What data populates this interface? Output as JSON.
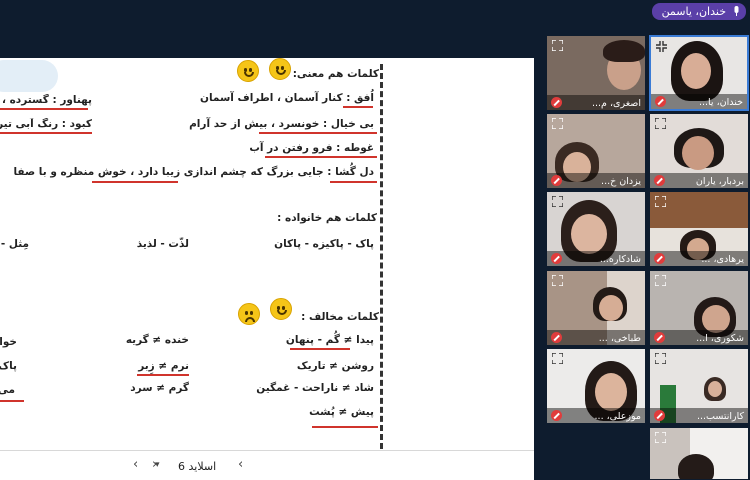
{
  "speaker": {
    "name": "خندان، یاسمن",
    "icon": "microphone-icon"
  },
  "slide": {
    "heading_synonyms": "کلمات هم معنی:",
    "heading_family": "کلمات هم خانواده :",
    "heading_antonyms": "کلمات مخالف :",
    "synonyms_right": [
      "اُفق : کنار آسمان ، اطراف آسمان",
      "بی خیال : خونسرد ، بیش از حد آرام",
      "غوطه : فرو رفتن در آب",
      "دل گُشا : جایی بزرگ که چشم اندازی زیبا دارد ، خوش منظره و با صفا"
    ],
    "synonyms_left": [
      "پهناور : گسترده ، وس",
      "کبود : رنگ آبی تیره"
    ],
    "family_row": [
      "پاک - پاکیزه - پاکان",
      "لذّت - لذیذ",
      "مِثل -"
    ],
    "antonyms_col1": [
      "پیدا ≠ گُم - پنهان",
      "روشن ≠ تاریک",
      "شاد ≠ ناراحت - غمگین",
      "پیش ≠ پُشت"
    ],
    "antonyms_col2": [
      "خنده ≠ گریه",
      "نرم ≠ زِبر",
      "گرم ≠ سرد"
    ],
    "antonyms_col3": [
      "خوا",
      "پاک",
      "می"
    ]
  },
  "nav": {
    "prev_icon": "chevron-left-icon",
    "next_icon": "chevron-right-icon",
    "dropdown_icon": "chevron-down-icon",
    "slide_label": "اسلاید 6"
  },
  "participants": [
    {
      "name": "اصغری، م..."
    },
    {
      "name": "خندان، یا..."
    },
    {
      "name": "یزدان خ..."
    },
    {
      "name": "بردبار، یاران"
    },
    {
      "name": "شادکاره..."
    },
    {
      "name": "یرهادی، ..."
    },
    {
      "name": "طباخی، ..."
    },
    {
      "name": "شکوری، ا..."
    },
    {
      "name": "موزعلی، ..."
    },
    {
      "name": "کارانتسب..."
    },
    {
      "name": ""
    }
  ],
  "colors": {
    "background": "#0e1c2e",
    "underline": "#d0342c",
    "speaker_badge": "#5a3fa8",
    "mute": "#e03c3c"
  }
}
